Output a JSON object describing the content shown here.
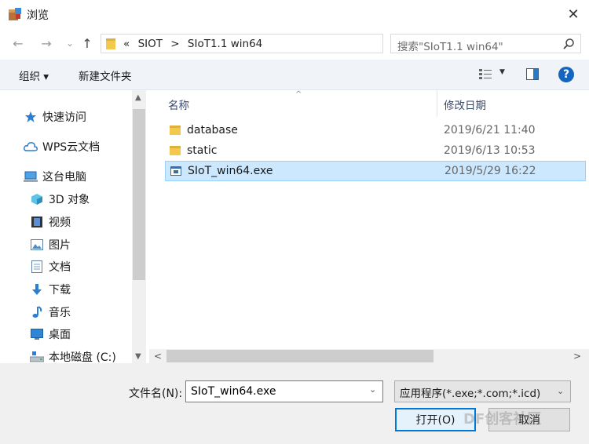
{
  "window": {
    "title": "浏览",
    "close_glyph": "✕"
  },
  "nav": {
    "back_glyph": "←",
    "forward_glyph": "→",
    "dropdown_glyph": "⌄",
    "up_glyph": "↑"
  },
  "address": {
    "overflow": "«",
    "crumbs": [
      "SIOT",
      ">",
      "SIoT1.1 win64"
    ],
    "refresh_glyph": "↻"
  },
  "search": {
    "placeholder": "搜索\"SIoT1.1 win64\""
  },
  "toolbar": {
    "organize": "组织 ▾",
    "new_folder": "新建文件夹",
    "help": "?",
    "view_drop": "▼"
  },
  "nav_pane": {
    "items": [
      {
        "label": "快速访问",
        "icon": "star-icon"
      },
      {
        "label": "WPS云文档",
        "icon": "cloud-icon"
      },
      {
        "label": "这台电脑",
        "icon": "computer-icon"
      },
      {
        "label": "3D 对象",
        "icon": "cube-icon"
      },
      {
        "label": "视频",
        "icon": "video-icon"
      },
      {
        "label": "图片",
        "icon": "picture-icon"
      },
      {
        "label": "文档",
        "icon": "document-icon"
      },
      {
        "label": "下载",
        "icon": "download-icon"
      },
      {
        "label": "音乐",
        "icon": "music-icon"
      },
      {
        "label": "桌面",
        "icon": "desktop-icon"
      },
      {
        "label": "本地磁盘 (C:)",
        "icon": "drive-icon"
      }
    ]
  },
  "file_list": {
    "columns": {
      "name": "名称",
      "date": "修改日期"
    },
    "sort_glyph": "^",
    "rows": [
      {
        "name": "database",
        "date": "2019/6/21 11:40",
        "type": "folder",
        "selected": false
      },
      {
        "name": "static",
        "date": "2019/6/13 10:53",
        "type": "folder",
        "selected": false
      },
      {
        "name": "SIoT_win64.exe",
        "date": "2019/5/29 16:22",
        "type": "exe",
        "selected": true
      }
    ]
  },
  "scroll": {
    "up": "▲",
    "down": "▼",
    "left": "<",
    "right": ">"
  },
  "bottom": {
    "filename_label": "文件名(N):",
    "filename_value": "SIoT_win64.exe",
    "filetype_value": "应用程序(*.exe;*.com;*.icd)",
    "open_label": "打开(O)",
    "cancel_label": "取消",
    "drop_glyph": "⌄"
  },
  "watermark": "DF创客社区"
}
